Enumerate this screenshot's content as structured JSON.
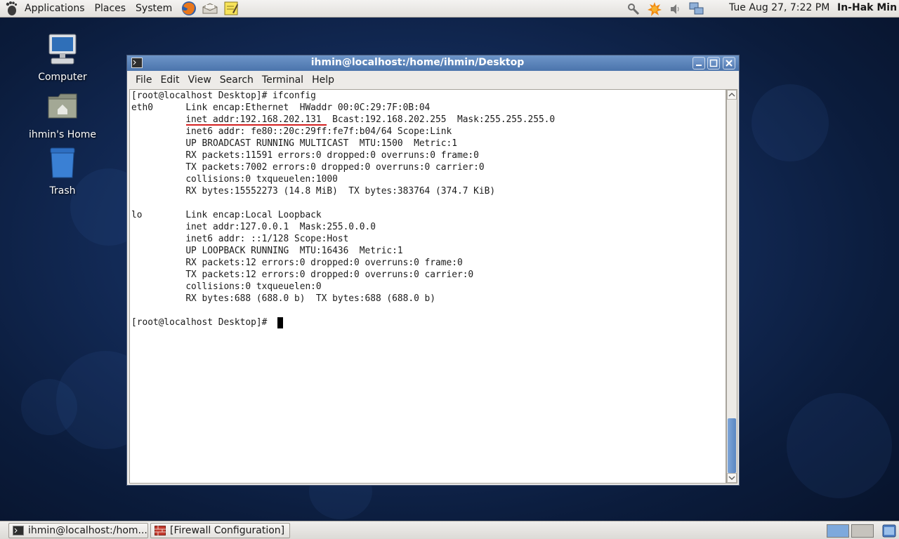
{
  "top_panel": {
    "menus": [
      "Applications",
      "Places",
      "System"
    ],
    "clock": "Tue Aug 27,  7:22 PM",
    "user": "In-Hak Min"
  },
  "desktop_icons": [
    {
      "label": "Computer"
    },
    {
      "label": "ihmin's Home"
    },
    {
      "label": "Trash"
    }
  ],
  "terminal": {
    "title": "ihmin@localhost:/home/ihmin/Desktop",
    "menu": [
      "File",
      "Edit",
      "View",
      "Search",
      "Terminal",
      "Help"
    ],
    "lines": [
      "[root@localhost Desktop]# ifconfig",
      "eth0      Link encap:Ethernet  HWaddr 00:0C:29:7F:0B:04  ",
      "          inet addr:192.168.202.131  Bcast:192.168.202.255  Mask:255.255.255.0",
      "          inet6 addr: fe80::20c:29ff:fe7f:b04/64 Scope:Link",
      "          UP BROADCAST RUNNING MULTICAST  MTU:1500  Metric:1",
      "          RX packets:11591 errors:0 dropped:0 overruns:0 frame:0",
      "          TX packets:7002 errors:0 dropped:0 overruns:0 carrier:0",
      "          collisions:0 txqueuelen:1000 ",
      "          RX bytes:15552273 (14.8 MiB)  TX bytes:383764 (374.7 KiB)",
      "",
      "lo        Link encap:Local Loopback  ",
      "          inet addr:127.0.0.1  Mask:255.0.0.0",
      "          inet6 addr: ::1/128 Scope:Host",
      "          UP LOOPBACK RUNNING  MTU:16436  Metric:1",
      "          RX packets:12 errors:0 dropped:0 overruns:0 frame:0",
      "          TX packets:12 errors:0 dropped:0 overruns:0 carrier:0",
      "          collisions:0 txqueuelen:0 ",
      "          RX bytes:688 (688.0 b)  TX bytes:688 (688.0 b)",
      "",
      "[root@localhost Desktop]# "
    ]
  },
  "taskbar": {
    "tasks": [
      {
        "label": "ihmin@localhost:/hom..."
      },
      {
        "label": "[Firewall Configuration]"
      }
    ]
  },
  "colors": {
    "title_bar": "#5a82ba",
    "highlight_underline": "#d42020",
    "desktop": "#142d5c"
  },
  "icons": [
    "gnome-foot-icon",
    "firefox-icon",
    "mail-icon",
    "notes-icon",
    "network-tool-icon",
    "update-icon",
    "volume-icon",
    "network-icon",
    "terminal-icon",
    "firewall-icon"
  ]
}
